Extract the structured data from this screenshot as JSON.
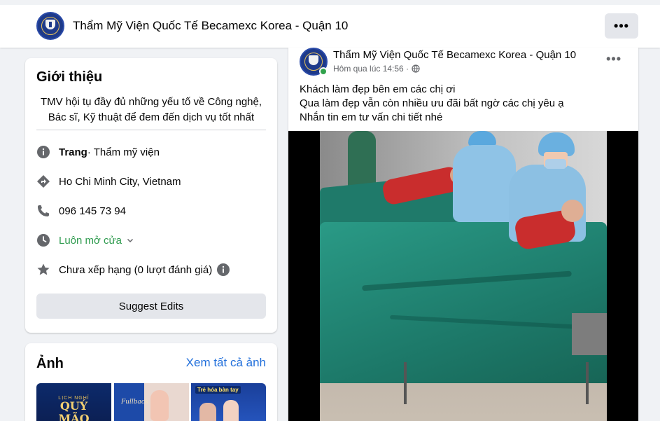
{
  "header": {
    "page_name": "Thẩm Mỹ Viện Quốc Tế Becamexc Korea - Quận 10",
    "more_label": "•••"
  },
  "intro": {
    "title": "Giới thiệu",
    "bio_line1": "TMV hội tụ đầy đủ những yếu tố về Công nghệ,",
    "bio_line2": "Bác sĩ, Kỹ thuật để đem đến dịch vụ tốt nhất",
    "page_label": "Trang",
    "category": " · Thẩm mỹ viện",
    "location": "Ho Chi Minh City, Vietnam",
    "phone": "096 145 73 94",
    "hours": "Luôn mở cửa",
    "rating": "Chưa xếp hạng (0 lượt đánh giá)",
    "suggest_label": "Suggest Edits"
  },
  "photos": {
    "title": "Ảnh",
    "see_all": "Xem tất cả ảnh",
    "thumbs": [
      {
        "small": "LỊCH NGHỈ",
        "big": "QUÝ",
        "big2": "MÃO"
      },
      {
        "script": "Fullback"
      },
      {
        "tag": "Trẻ hóa bàn tay"
      }
    ]
  },
  "post": {
    "page_name": "Thẩm Mỹ Viện Quốc Tế Becamexc Korea - Quận 10",
    "time": "Hôm qua lúc 14:56 ·",
    "more_label": "•••",
    "text_line1": "Khách làm đẹp bên em các chị ơi",
    "text_line2": "Qua làm đẹp vẫn còn nhiều ưu đãi bất ngờ các chị yêu ạ",
    "text_line3": "Nhắn tin em tư vấn chi tiết nhé"
  },
  "colors": {
    "accent_blue": "#216fdb",
    "open_green": "#2e9b4e",
    "online_green": "#31a24c"
  }
}
